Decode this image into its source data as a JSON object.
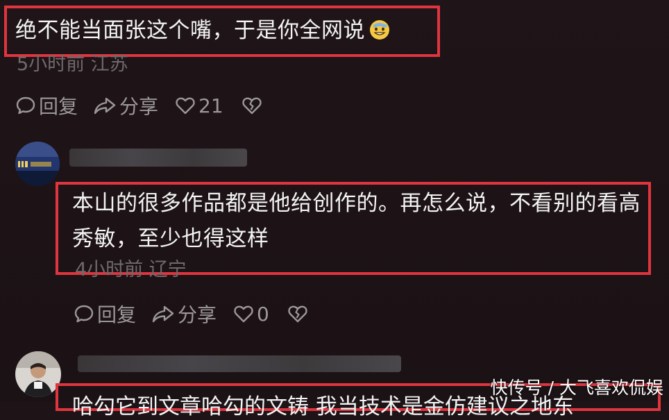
{
  "comments": [
    {
      "text": "绝不能当面张这个嘴，于是你全网说",
      "emoji": "sweat-smile-emoji",
      "meta": "5小时前 江苏",
      "actions": {
        "reply_label": "回复",
        "share_label": "分享",
        "like_count": "21"
      }
    },
    {
      "text": "本山的很多作品都是他给创作的。再怎么说，不看别的看高秀敏，至少也得这样",
      "meta": "4小时前 辽宁",
      "actions": {
        "reply_label": "回复",
        "share_label": "分享",
        "like_count": "0"
      }
    },
    {
      "text": "哈勾它到文章哈勾的文铸 我当技术是金仿建议之地东"
    }
  ],
  "highlight_color": "#e0353f",
  "watermark": "快传号 / 大飞喜欢侃娱"
}
